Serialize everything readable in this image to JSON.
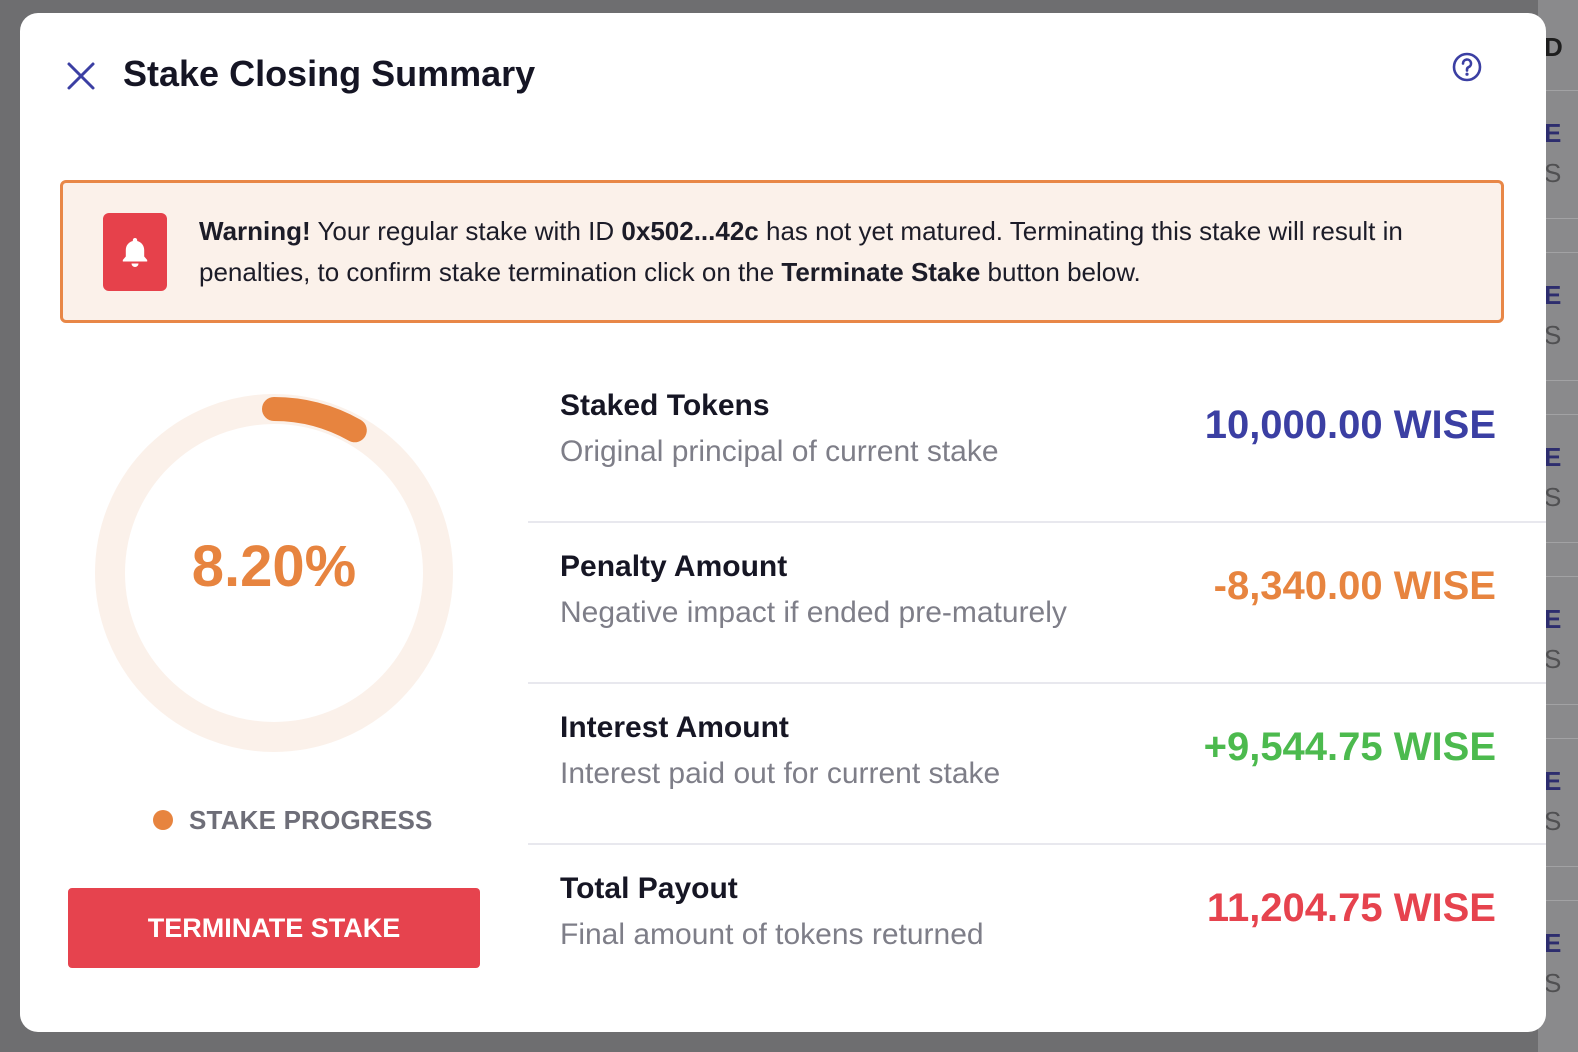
{
  "modal": {
    "title": "Stake Closing Summary"
  },
  "warning": {
    "prefix": "Warning!",
    "text_part1": " Your regular stake with ID ",
    "stake_id": "0x502...42c",
    "text_part2": " has not yet matured. Terminating this stake will result in penalties, to confirm stake termination click on the ",
    "button_ref": "Terminate Stake",
    "text_part3": " button below."
  },
  "progress": {
    "value_text": "8.20%",
    "value": 8.2,
    "label": "STAKE PROGRESS",
    "color": "#e7843f",
    "track_color": "#fbf1ea"
  },
  "terminate_button": {
    "label": "TERMINATE STAKE",
    "color": "#e6434e"
  },
  "summary": [
    {
      "title": "Staked Tokens",
      "description": "Original principal of current stake",
      "value": "10,000.00 WISE",
      "color": "#3b3fa3"
    },
    {
      "title": "Penalty Amount",
      "description": "Negative impact if ended pre-maturely",
      "value": "-8,340.00 WISE",
      "color": "#e7843f"
    },
    {
      "title": "Interest Amount",
      "description": "Interest paid out for current stake",
      "value": "+9,544.75 WISE",
      "color": "#4cba4e"
    },
    {
      "title": "Total Payout",
      "description": "Final amount of tokens returned",
      "value": "11,204.75 WISE",
      "color": "#e6434e"
    }
  ],
  "background": {
    "chars": [
      "D",
      "E",
      "S",
      "E",
      "S",
      "E",
      "S",
      "E",
      "S",
      "E",
      "S",
      "E",
      "S"
    ]
  },
  "icons": {
    "close": "close-icon",
    "help": "help-circle-icon",
    "warning": "bell-icon"
  }
}
